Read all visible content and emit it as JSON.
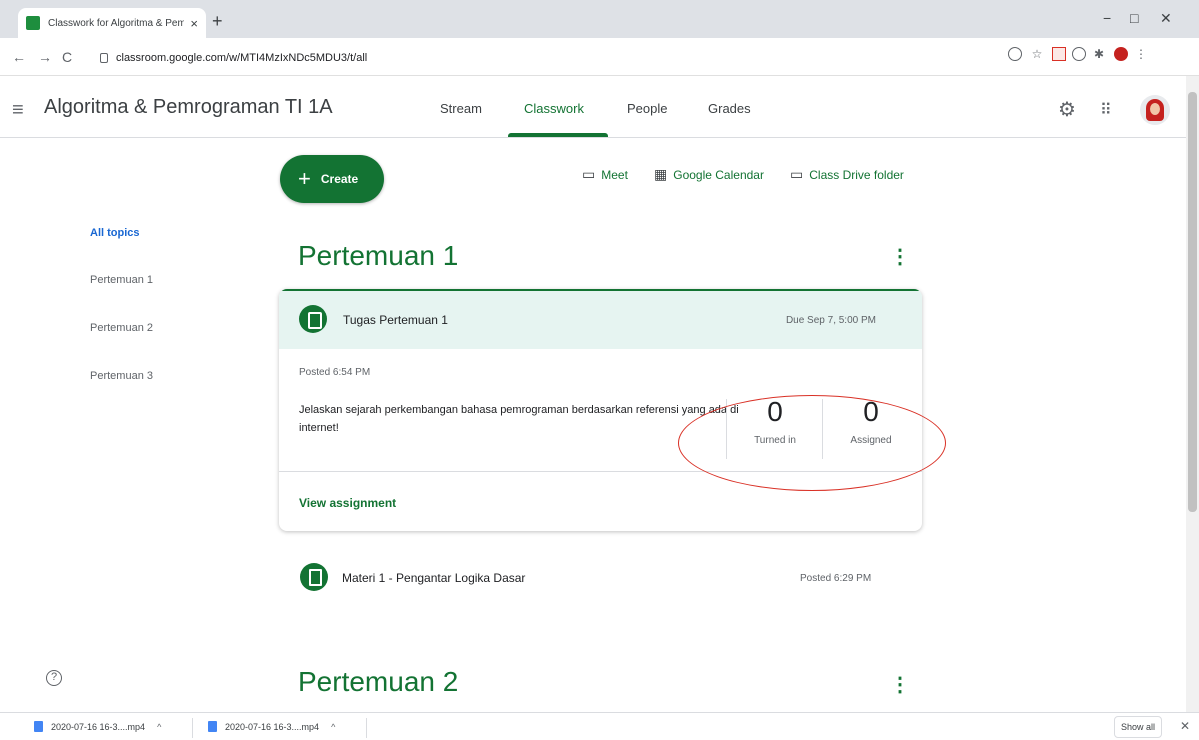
{
  "browser": {
    "tab_title": "Classwork for Algoritma & Pemr",
    "tab_close": "×",
    "new_tab": "+",
    "url": "classroom.google.com/w/MTI4MzIxNDc5MDU3/t/all",
    "nav": {
      "back": "←",
      "forward": "→",
      "reload": "C"
    },
    "window": {
      "minimize": "−",
      "maximize": "□",
      "close": "✕"
    }
  },
  "header": {
    "menu_icon": "≡",
    "class_title": "Algoritma & Pemrograman TI 1A",
    "tabs": [
      {
        "label": "Stream",
        "active": false
      },
      {
        "label": "Classwork",
        "active": true
      },
      {
        "label": "People",
        "active": false
      },
      {
        "label": "Grades",
        "active": false
      }
    ]
  },
  "toolbar": {
    "create_icon": "+",
    "create_label": "Create",
    "meet_label": "Meet",
    "calendar_label": "Google Calendar",
    "drive_label": "Class Drive folder"
  },
  "sidebar": {
    "topics": [
      {
        "label": "All topics",
        "active": true
      },
      {
        "label": "Pertemuan 1",
        "active": false
      },
      {
        "label": "Pertemuan 2",
        "active": false
      },
      {
        "label": "Pertemuan 3",
        "active": false
      }
    ]
  },
  "sections": [
    {
      "title": "Pertemuan 1",
      "assignment": {
        "title": "Tugas Pertemuan 1",
        "due": "Due Sep 7, 5:00 PM",
        "posted": "Posted 6:54 PM",
        "description": "Jelaskan sejarah perkembangan bahasa pemrograman berdasarkan referensi yang ada di internet!",
        "turned_in_count": "0",
        "turned_in_label": "Turned in",
        "assigned_count": "0",
        "assigned_label": "Assigned",
        "view_label": "View assignment"
      },
      "material": {
        "title": "Materi 1 - Pengantar Logika Dasar",
        "posted": "Posted 6:29 PM"
      }
    },
    {
      "title": "Pertemuan 2"
    }
  ],
  "kebab_icon": "⋮",
  "help_icon": "?",
  "downloads": {
    "items": [
      {
        "name": "2020-07-16 16-3....mp4"
      },
      {
        "name": "2020-07-16 16-3....mp4"
      }
    ],
    "caret": "^",
    "show_all_label": "Show all",
    "close": "✕"
  },
  "colors": {
    "accent": "#137333",
    "annotation": "#d93025"
  }
}
